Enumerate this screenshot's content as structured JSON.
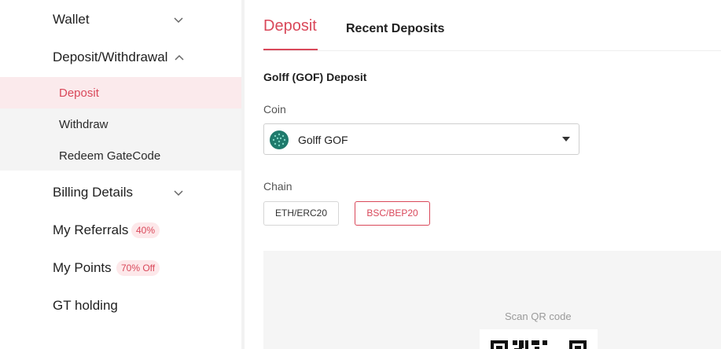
{
  "sidebar": {
    "wallet": {
      "label": "Wallet"
    },
    "deposit_withdrawal": {
      "label": "Deposit/Withdrawal",
      "items": [
        {
          "label": "Deposit",
          "active": true
        },
        {
          "label": "Withdraw"
        },
        {
          "label": "Redeem GateCode"
        }
      ]
    },
    "billing": {
      "label": "Billing Details"
    },
    "referrals": {
      "label": "My Referrals",
      "badge": "40%"
    },
    "points": {
      "label": "My Points",
      "badge": "70% Off"
    },
    "gt_holding": {
      "label": "GT holding"
    }
  },
  "tabs": [
    {
      "label": "Deposit",
      "active": true
    },
    {
      "label": "Recent Deposits"
    }
  ],
  "form": {
    "title": "Golff (GOF) Deposit",
    "coin_label": "Coin",
    "coin_value": "Golff GOF",
    "chain_label": "Chain",
    "chains": [
      {
        "label": "ETH/ERC20"
      },
      {
        "label": "BSC/BEP20",
        "selected": true
      }
    ]
  },
  "qr": {
    "caption": "Scan QR code"
  },
  "colors": {
    "accent": "#d9485a",
    "badge_bg": "#fde8ea",
    "coin_logo": "#2f9c8a"
  },
  "icons": {
    "expand": "chevron-down-icon",
    "collapse": "chevron-up-icon",
    "dropdown": "caret-down-icon"
  }
}
